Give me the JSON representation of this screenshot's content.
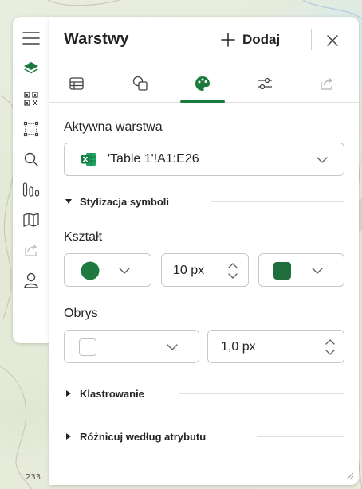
{
  "map": {
    "scale_label": "233"
  },
  "toolbar": {
    "items": [
      {
        "name": "menu-icon"
      },
      {
        "name": "layers-icon"
      },
      {
        "name": "qr-grid-icon"
      },
      {
        "name": "select-area-icon"
      },
      {
        "name": "search-icon"
      },
      {
        "name": "chart-icon"
      },
      {
        "name": "map-icon"
      },
      {
        "name": "share-icon"
      },
      {
        "name": "user-icon"
      }
    ]
  },
  "panel": {
    "title": "Warstwy",
    "add_label": "Dodaj",
    "tabs": [
      {
        "name": "table-icon",
        "active": false
      },
      {
        "name": "shapes-icon",
        "active": false
      },
      {
        "name": "palette-icon",
        "active": true
      },
      {
        "name": "sliders-icon",
        "active": false
      },
      {
        "name": "export-icon",
        "active": false
      }
    ],
    "active_layer_label": "Aktywna warstwa",
    "active_layer_value": "'Table 1'!A1:E26",
    "symbol_styling_label": "Stylizacja symboli",
    "shape_label": "Kształt",
    "shape_size": "10 px",
    "outline_label": "Obrys",
    "outline_width": "1,0 px",
    "clustering_label": "Klastrowanie",
    "vary_by_attribute_label": "Różnicuj według atrybutu"
  },
  "colors": {
    "accent": "#1b7a3c",
    "shape_fill": "#1e7a3e",
    "shape_color_swatch": "#1f6e3c",
    "outline_swatch": "#ffffff"
  }
}
